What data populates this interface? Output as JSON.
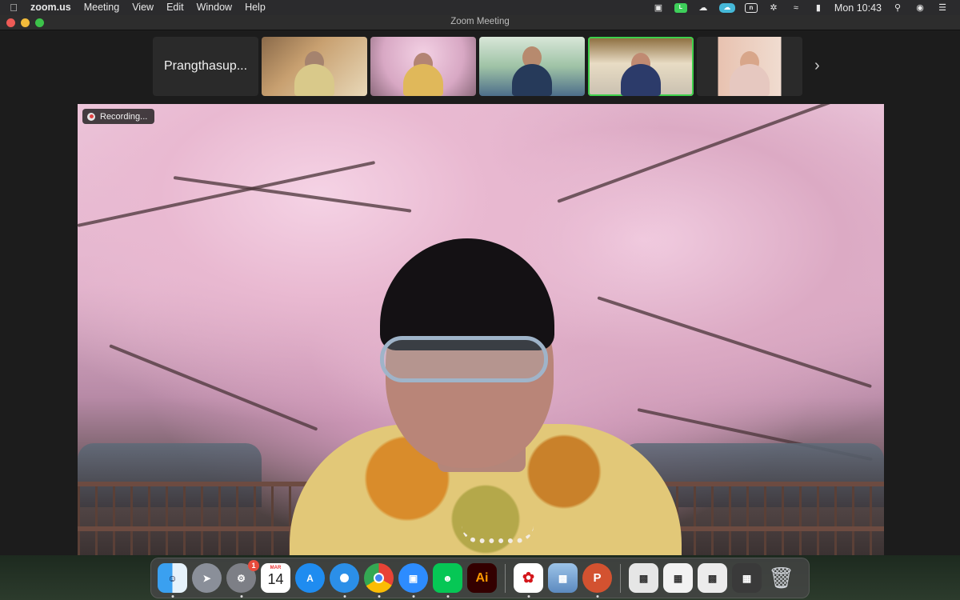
{
  "menubar": {
    "app_name": "zoom.us",
    "menus": [
      "Meeting",
      "View",
      "Edit",
      "Window",
      "Help"
    ],
    "clock": "Mon 10:43"
  },
  "window": {
    "title": "Zoom Meeting"
  },
  "thumbnails": {
    "name_tile_label": "Prangthasup..."
  },
  "main_video": {
    "recording_label": "Recording..."
  },
  "dock": {
    "calendar_month": "MAR",
    "calendar_day": "14",
    "system_prefs_badge": "1",
    "illustrator_label": "Ai"
  }
}
